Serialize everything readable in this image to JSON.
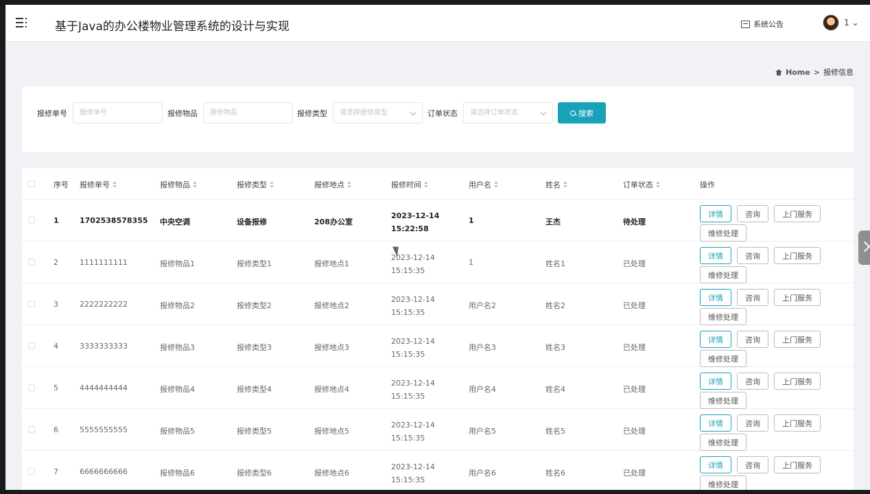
{
  "header": {
    "title": "基于Java的办公楼物业管理系统的设计与实现",
    "notice_label": "系统公告",
    "user": "1"
  },
  "breadcrumb": {
    "home": "Home",
    "separator": ">",
    "current": "报修信息"
  },
  "search": {
    "fields": [
      {
        "label": "报修单号",
        "placeholder": "报修单号"
      },
      {
        "label": "报修物品",
        "placeholder": "报修物品"
      },
      {
        "label": "报修类型",
        "placeholder": "请选择报修类型"
      },
      {
        "label": "订单状态",
        "placeholder": "请选择订单状态"
      }
    ],
    "button_label": "搜索"
  },
  "table": {
    "columns": [
      "序号",
      "报修单号",
      "报修物品",
      "报修类型",
      "报修地点",
      "报修时间",
      "用户名",
      "姓名",
      "订单状态",
      "操作"
    ],
    "rows": [
      [
        "1",
        "1702538578355",
        "中央空调",
        "设备报修",
        "208办公室",
        "2023-12-14 15:22:58",
        "1",
        "王杰",
        "待处理"
      ],
      [
        "2",
        "1111111111",
        "报修物品1",
        "报修类型1",
        "报修地点1",
        "2023-12-14 15:15:35",
        "1",
        "姓名1",
        "已处理"
      ],
      [
        "3",
        "2222222222",
        "报修物品2",
        "报修类型2",
        "报修地点2",
        "2023-12-14 15:15:35",
        "用户名2",
        "姓名2",
        "已处理"
      ],
      [
        "4",
        "3333333333",
        "报修物品3",
        "报修类型3",
        "报修地点3",
        "2023-12-14 15:15:35",
        "用户名3",
        "姓名3",
        "已处理"
      ],
      [
        "5",
        "4444444444",
        "报修物品4",
        "报修类型4",
        "报修地点4",
        "2023-12-14 15:15:35",
        "用户名4",
        "姓名4",
        "已处理"
      ],
      [
        "6",
        "5555555555",
        "报修物品5",
        "报修类型5",
        "报修地点5",
        "2023-12-14 15:15:35",
        "用户名5",
        "姓名5",
        "已处理"
      ],
      [
        "7",
        "6666666666",
        "报修物品6",
        "报修类型6",
        "报修地点6",
        "2023-12-14 15:15:35",
        "用户名6",
        "姓名6",
        "已处理"
      ]
    ],
    "actions": [
      "详情",
      "咨询",
      "上门服务",
      "维修处理"
    ]
  },
  "colors": {
    "accent": "#17a2b8",
    "background": "#f1f2f6"
  }
}
